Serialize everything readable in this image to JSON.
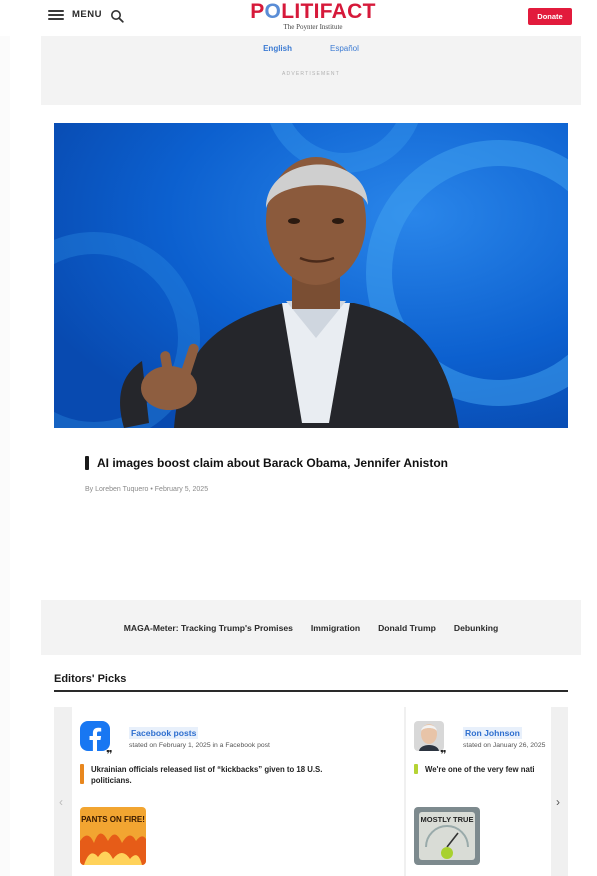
{
  "header": {
    "menu_label": "MENU",
    "logo_text_a": "P",
    "logo_text_o": "O",
    "logo_text_b": "LITIFACT",
    "logo_sub": "The Poynter Institute",
    "donate_label": "Donate"
  },
  "lang": {
    "english": "English",
    "espanol": "Español"
  },
  "ad": {
    "label": "ADVERTISEMENT"
  },
  "hero": {
    "title": "AI images boost claim about Barack Obama, Jennifer Aniston",
    "byline": "By Loreben Tuquero • February 5, 2025"
  },
  "topics": [
    "MAGA-Meter: Tracking Trump's Promises",
    "Immigration",
    "Donald Trump",
    "Debunking"
  ],
  "editors_picks": {
    "title": "Editors' Picks",
    "cards": [
      {
        "source": "Facebook posts",
        "stated": "stated on February 1, 2025 in a Facebook post",
        "claim": "Ukrainian officials released list of “kickbacks” given to 18 U.S. politicians.",
        "rating": "PANTS ON FIRE!",
        "rating_color": "#e8871e"
      },
      {
        "source": "Ron Johnson",
        "stated": "stated on January 26, 2025",
        "claim": "We're one of the very few nati",
        "rating": "MOSTLY TRUE",
        "rating_color": "#b5d334"
      }
    ]
  },
  "colors": {
    "brand_red": "#d6193a",
    "link_blue": "#3c7bd3",
    "donate": "#e21b3c"
  }
}
